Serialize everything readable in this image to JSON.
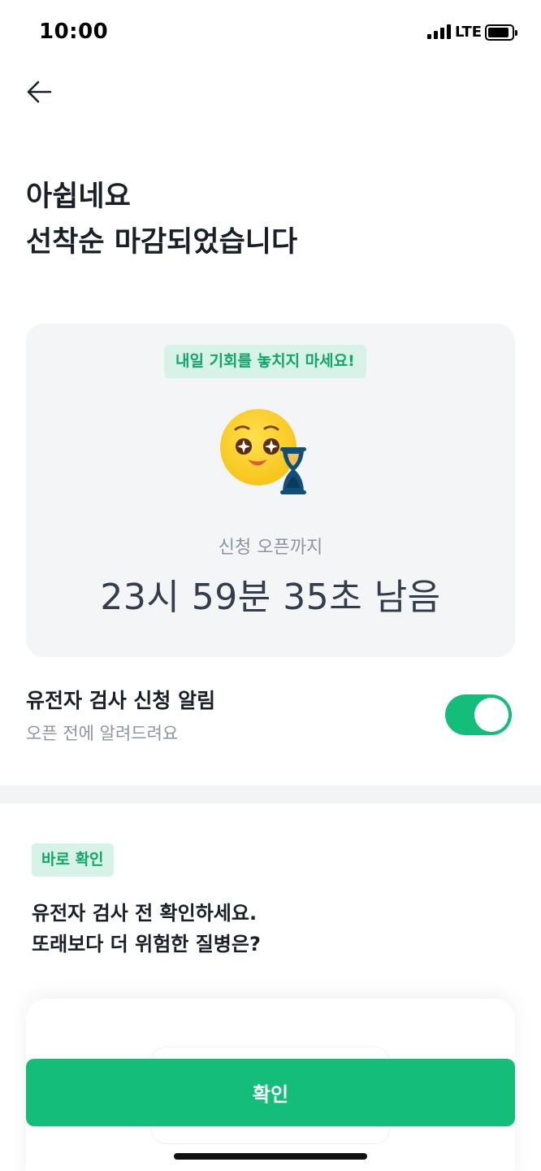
{
  "status_bar": {
    "time": "10:00",
    "network": "LTE"
  },
  "title": {
    "line1": "아쉽네요",
    "line2": "선착순 마감되었습니다"
  },
  "card": {
    "chip": "내일 기회를 놓치지 마세요!",
    "until_label": "신청 오픈까지",
    "countdown": "23시 59분 35초 남음",
    "mascot_icon": "smiling-face-hourglass-icon"
  },
  "notification": {
    "title": "유전자 검사 신청 알림",
    "subtitle": "오픈 전에 알려드려요",
    "toggle_on": true
  },
  "quick": {
    "chip": "바로 확인",
    "line1": "유전자 검사 전 확인하세요.",
    "line2": "또래보다 더 위험한 질병은?"
  },
  "confirm_label": "확인",
  "colors": {
    "accent": "#15bd7b",
    "chip_bg": "#d7f2e6",
    "chip_text": "#13a66b"
  }
}
